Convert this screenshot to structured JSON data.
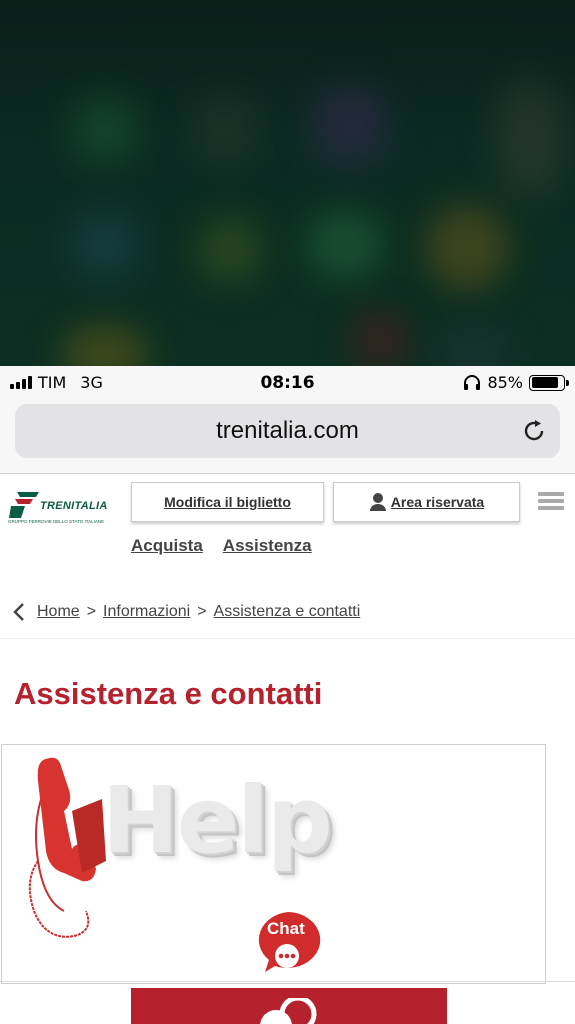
{
  "status_bar": {
    "carrier": "TIM",
    "network": "3G",
    "time": "08:16",
    "battery": "85%",
    "battery_level": 0.85,
    "icons": [
      "signal-icon",
      "headphones-icon",
      "battery-icon"
    ]
  },
  "browser": {
    "url": "trenitalia.com",
    "reload_icon": "reload-icon"
  },
  "header": {
    "logo_text": "TRENITALIA",
    "logo_subtext": "GRUPPO FERROVIE DELLO STATO ITALIANE",
    "modifica_label": "Modifica il biglietto",
    "area_label": "Area riservata",
    "nav": [
      "Acquista",
      "Assistenza"
    ]
  },
  "breadcrumb": {
    "items": [
      "Home",
      "Informazioni",
      "Assistenza e contatti"
    ],
    "separator": ">"
  },
  "main": {
    "title": "Assistenza e contatti",
    "help_image_text": "Help",
    "chat_label": "Chat"
  },
  "colors": {
    "brand_red": "#b5222e",
    "brand_green": "#0b5c44",
    "backdrop": "#0b2e22"
  }
}
